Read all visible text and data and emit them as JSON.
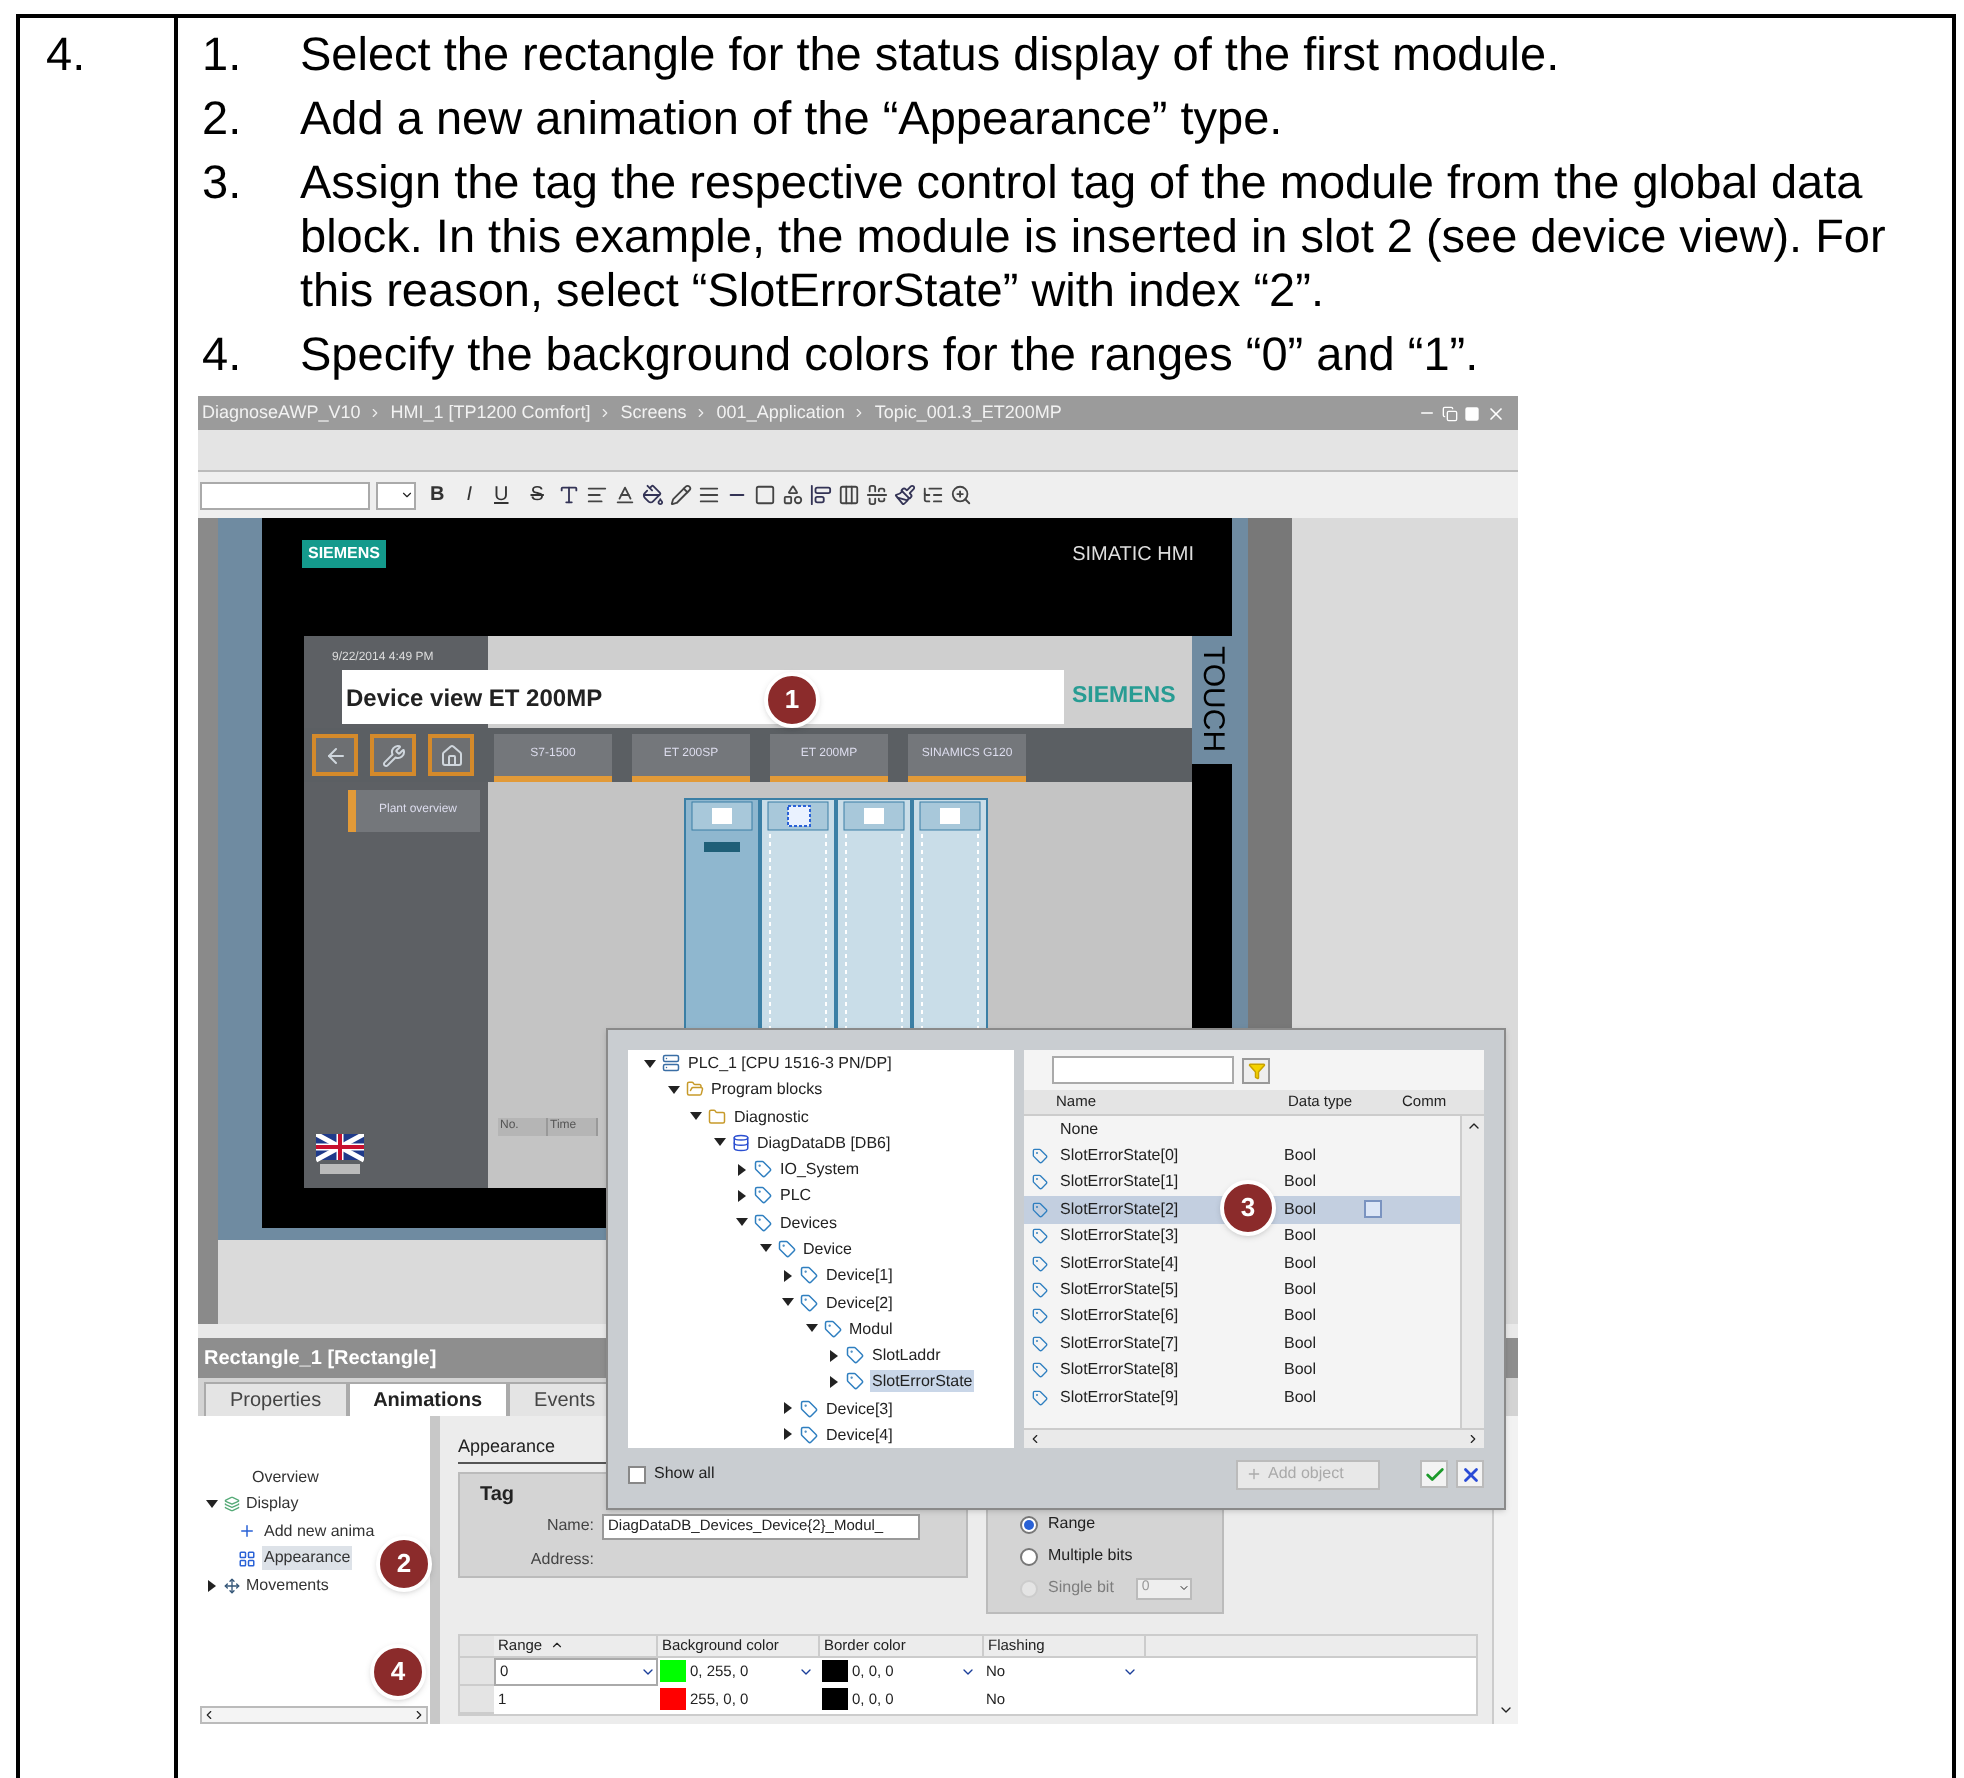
{
  "step_number": "4.",
  "steps": [
    {
      "number": "1.",
      "text": "Select the rectangle for the status display of the first module."
    },
    {
      "number": "2.",
      "text": "Add a new animation of the “Appearance” type."
    },
    {
      "number": "3.",
      "text": "Assign the tag the respective control tag of the module from the global data block. In this example, the module is inserted in slot 2 (see device view). For this reason, select “SlotErrorState” with index “2”."
    },
    {
      "number": "4.",
      "text": "Specify the background colors for the ranges “0” and “1”."
    }
  ],
  "window": {
    "breadcrumb": [
      "DiagnoseAWP_V10",
      "HMI_1 [TP1200 Comfort]",
      "Screens",
      "001_Application",
      "Topic_001.3_ET200MP"
    ]
  },
  "toolbar": {
    "format_buttons": [
      {
        "label": "B",
        "kind": "bold"
      },
      {
        "label": "I",
        "kind": "italic"
      },
      {
        "label": "U",
        "kind": "underline"
      },
      {
        "label": "S",
        "kind": "strike"
      }
    ]
  },
  "hmi": {
    "brand": "SIEMENS",
    "product": "SIMATIC HMI",
    "touch_label": "TOUCH",
    "datetime": "9/22/2014 4:49 PM",
    "screen_title": "Device view ET 200MP",
    "title_brand": "SIEMENS",
    "nav_tabs": [
      "S7-1500",
      "ET 200SP",
      "ET 200MP",
      "SINAMICS G120"
    ],
    "plant_button": "Plant overview",
    "alarm_columns": [
      "No.",
      "Time"
    ]
  },
  "tag_dialog": {
    "tree": [
      {
        "label": "PLC_1 [CPU 1516-3 PN/DP]",
        "kind": "plc",
        "expanded": true,
        "selected": false,
        "children": [
          {
            "label": "Program blocks",
            "kind": "folder",
            "expanded": true,
            "selected": false,
            "children": [
              {
                "label": "Diagnostic",
                "kind": "group",
                "expanded": true,
                "selected": false,
                "children": [
                  {
                    "label": "DiagDataDB [DB6]",
                    "kind": "db",
                    "expanded": true,
                    "selected": false,
                    "children": [
                      {
                        "label": "IO_System",
                        "kind": "tag",
                        "expanded": false,
                        "selected": false
                      },
                      {
                        "label": "PLC",
                        "kind": "tag",
                        "expanded": false,
                        "selected": false
                      },
                      {
                        "label": "Devices",
                        "kind": "tag",
                        "expanded": true,
                        "selected": false,
                        "children": [
                          {
                            "label": "Device",
                            "kind": "tag",
                            "expanded": true,
                            "selected": false,
                            "children": [
                              {
                                "label": "Device[1]",
                                "kind": "tag",
                                "expanded": false,
                                "selected": false
                              },
                              {
                                "label": "Device[2]",
                                "kind": "tag",
                                "expanded": true,
                                "selected": false,
                                "children": [
                                  {
                                    "label": "Modul",
                                    "kind": "tag",
                                    "expanded": true,
                                    "selected": false,
                                    "children": [
                                      {
                                        "label": "SlotLaddr",
                                        "kind": "tag",
                                        "expanded": false,
                                        "selected": false
                                      },
                                      {
                                        "label": "SlotErrorState",
                                        "kind": "tag",
                                        "expanded": false,
                                        "selected": true
                                      }
                                    ]
                                  }
                                ]
                              },
                              {
                                "label": "Device[3]",
                                "kind": "tag",
                                "expanded": false,
                                "selected": false
                              },
                              {
                                "label": "Device[4]",
                                "kind": "tag",
                                "expanded": false,
                                "selected": false
                              }
                            ]
                          }
                        ]
                      }
                    ]
                  }
                ]
              }
            ]
          }
        ]
      }
    ],
    "columns": [
      "Name",
      "Data type",
      "Comm"
    ],
    "rows": [
      {
        "name": "None",
        "kind": "none",
        "selected": false
      },
      {
        "name": "SlotErrorState[0]",
        "kind": "tag",
        "type": "Bool",
        "selected": false
      },
      {
        "name": "SlotErrorState[1]",
        "kind": "tag",
        "type": "Bool",
        "selected": false
      },
      {
        "name": "SlotErrorState[2]",
        "kind": "tag",
        "type": "Bool",
        "selected": true
      },
      {
        "name": "SlotErrorState[3]",
        "kind": "tag",
        "type": "Bool",
        "selected": false
      },
      {
        "name": "SlotErrorState[4]",
        "kind": "tag",
        "type": "Bool",
        "selected": false
      },
      {
        "name": "SlotErrorState[5]",
        "kind": "tag",
        "type": "Bool",
        "selected": false
      },
      {
        "name": "SlotErrorState[6]",
        "kind": "tag",
        "type": "Bool",
        "selected": false
      },
      {
        "name": "SlotErrorState[7]",
        "kind": "tag",
        "type": "Bool",
        "selected": false
      },
      {
        "name": "SlotErrorState[8]",
        "kind": "tag",
        "type": "Bool",
        "selected": false
      },
      {
        "name": "SlotErrorState[9]",
        "kind": "tag",
        "type": "Bool",
        "selected": false
      }
    ],
    "show_all": {
      "label": "Show all",
      "checked": false
    },
    "add_button": {
      "label": "Add object",
      "disabled": true
    }
  },
  "properties": {
    "title": "Rectangle_1 [Rectangle]",
    "tabs": [
      {
        "label": "Properties",
        "selected": false
      },
      {
        "label": "Animations",
        "selected": true
      },
      {
        "label": "Events",
        "selected": false
      }
    ],
    "nav": [
      {
        "label": "Overview",
        "kind": "plain",
        "selected": false
      },
      {
        "label": "Display",
        "kind": "group",
        "expanded": true,
        "selected": false,
        "children": [
          {
            "label": "Add new anima",
            "kind": "add",
            "selected": false
          },
          {
            "label": "Appearance",
            "kind": "appearance",
            "selected": true
          }
        ]
      },
      {
        "label": "Movements",
        "kind": "movement",
        "expanded": false,
        "selected": false
      }
    ],
    "section": "Appearance",
    "tag_group": {
      "title": "Tag",
      "name_label": "Name:",
      "name_value": "DiagDataDB_Devices_Device{2}_Modul_",
      "address_label": "Address:"
    },
    "type_options": [
      {
        "label": "Range",
        "selected": true,
        "disabled": false
      },
      {
        "label": "Multiple bits",
        "selected": false,
        "disabled": false
      },
      {
        "label": "Single bit",
        "selected": false,
        "disabled": true
      }
    ],
    "bit_spinner": "0",
    "table": {
      "columns": [
        "Range",
        "Background color",
        "Border color",
        "Flashing"
      ],
      "rows": [
        {
          "range": "0",
          "background": {
            "color": "#00ff00",
            "text": "0, 255, 0"
          },
          "border": {
            "color": "#000000",
            "text": "0, 0, 0"
          },
          "flashing": "No",
          "editing": true
        },
        {
          "range": "1",
          "background": {
            "color": "#ff0000",
            "text": "255, 0, 0"
          },
          "border": {
            "color": "#000000",
            "text": "0, 0, 0"
          },
          "flashing": "No",
          "editing": false
        }
      ]
    }
  },
  "callouts": [
    {
      "label": "1"
    },
    {
      "label": "2"
    },
    {
      "label": "3"
    },
    {
      "label": "4"
    }
  ]
}
